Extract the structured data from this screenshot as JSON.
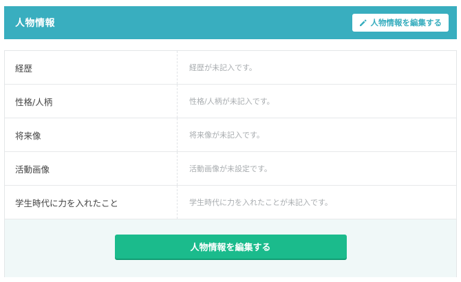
{
  "header": {
    "title": "人物情報",
    "edit_button_label": "人物情報を編集する"
  },
  "rows": [
    {
      "label": "経歴",
      "value": "経歴が未記入です。"
    },
    {
      "label": "性格/人柄",
      "value": "性格/人柄が未記入です。"
    },
    {
      "label": "将来像",
      "value": "将来像が未記入です。"
    },
    {
      "label": "活動画像",
      "value": "活動画像が未設定です。"
    },
    {
      "label": "学生時代に力を入れたこと",
      "value": "学生時代に力を入れたことが未記入です。"
    }
  ],
  "footer": {
    "edit_button_label": "人物情報を編集する"
  },
  "colors": {
    "header_bg": "#39aebf",
    "primary_button": "#1bbb8c",
    "footer_bg": "#f0f8f8"
  },
  "icons": {
    "edit": "pencil-icon"
  }
}
